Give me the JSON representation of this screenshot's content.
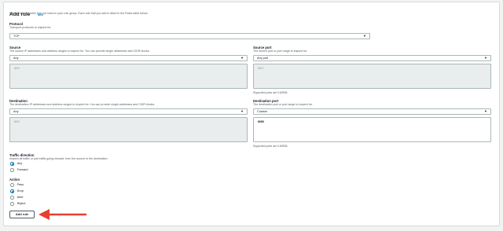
{
  "header": {
    "title": "Add rule",
    "info_link": "Info",
    "description": "Add the stateful rules that you need in your rule group. Each rule that you add is listed in the Rules table below."
  },
  "protocol": {
    "label": "Protocol",
    "description": "Transport protocols to inspect for.",
    "value": "TCP"
  },
  "source": {
    "label": "Source",
    "description": "The source IP addresses and address ranges to inspect for. You can provide single addresses and CIDR blocks.",
    "value": "Any",
    "textarea_placeholder": "ANY"
  },
  "source_port": {
    "label": "Source port",
    "description": "The source port or port range to inspect for.",
    "value": "Any port",
    "textarea_placeholder": "ANY",
    "hint": "Supported ports are 0-65535."
  },
  "destination": {
    "label": "Destination",
    "description": "The destination IP addresses and address ranges to inspect for. You can provide single addresses and CIDR blocks.",
    "value": "Any",
    "textarea_placeholder": "ANY"
  },
  "destination_port": {
    "label": "Destination port",
    "description": "The destination port or port range to inspect for.",
    "value": "Custom",
    "textarea_value": "8080",
    "hint": "Supported ports are 0-65535."
  },
  "traffic_direction": {
    "label": "Traffic direction",
    "description": "Inspect all traffic or just traffic going forward, from the source to the destination.",
    "options": [
      "Any",
      "Forward"
    ],
    "selected": "Any"
  },
  "action": {
    "label": "Action",
    "options": [
      "Pass",
      "Drop",
      "Alert",
      "Reject"
    ],
    "selected": "Drop"
  },
  "add_rule_button": "Add rule",
  "colors": {
    "accent": "#0073bb",
    "arrow": "#e8402f",
    "disabled_field": "#eaeded"
  },
  "icons": {
    "dropdown": "caret-down-icon",
    "annotation": "red-arrow-icon"
  }
}
